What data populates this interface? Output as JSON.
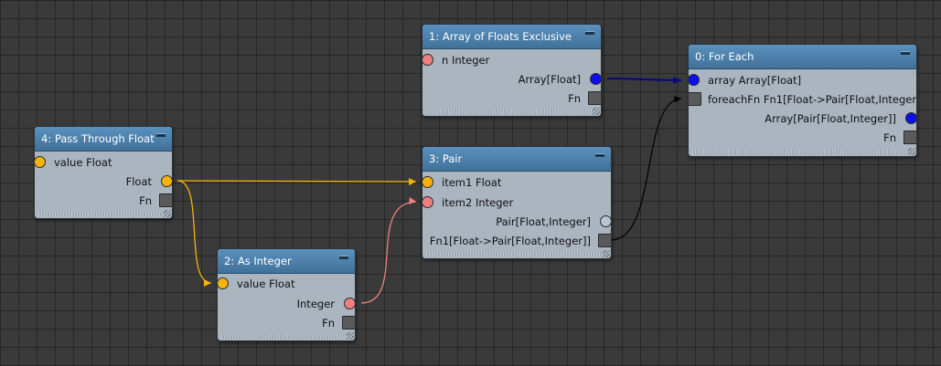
{
  "colors": {
    "float": "#f7b30a",
    "integer": "#f08080",
    "array": "#0e0ef0",
    "pair": "#b8c4d2",
    "function": "#5a5a5a",
    "wire_array": "#0b0b7a",
    "wire_function": "#000000"
  },
  "nodes": {
    "pass_through_float": {
      "title": "4: Pass Through Float",
      "input_value": "value Float",
      "output_float": "Float",
      "output_fn": "Fn"
    },
    "as_integer": {
      "title": "2: As Integer",
      "input_value": "value Float",
      "output_integer": "Integer",
      "output_fn": "Fn"
    },
    "array_of_floats": {
      "title": "1: Array of Floats Exclusive",
      "input_n": "n Integer",
      "output_array": "Array[Float]",
      "output_fn": "Fn"
    },
    "pair": {
      "title": "3: Pair",
      "input_item1": "item1 Float",
      "input_item2": "item2 Integer",
      "output_pair": "Pair[Float,Integer]",
      "output_fn": "Fn1[Float->Pair[Float,Integer]]"
    },
    "for_each": {
      "title": "0: For Each",
      "input_array": "array Array[Float]",
      "input_foreach_fn": "foreachFn Fn1[Float->Pair[Float,Integer]]",
      "output_array": "Array[Pair[Float,Integer]]",
      "output_fn": "Fn"
    }
  }
}
